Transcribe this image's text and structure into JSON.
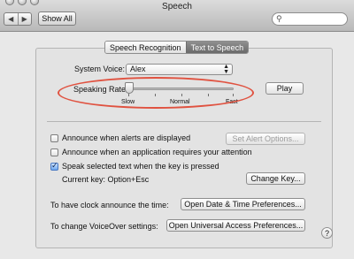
{
  "window": {
    "title": "Speech"
  },
  "toolbar": {
    "back_icon": "◀",
    "forward_icon": "▶",
    "show_all_label": "Show All",
    "search_icon": "⚲",
    "search_placeholder": ""
  },
  "tabs": [
    {
      "label": "Speech Recognition",
      "active": false
    },
    {
      "label": "Text to Speech",
      "active": true
    }
  ],
  "voice": {
    "label": "System Voice:",
    "selected": "Alex",
    "arrows": "▲▼"
  },
  "rate": {
    "label": "Speaking Rate:",
    "slow": "Slow",
    "normal": "Normal",
    "fast": "Fast",
    "value_fraction": 0.0
  },
  "play_label": "Play",
  "options": [
    {
      "label": "Announce when alerts are displayed",
      "checked": false
    },
    {
      "label": "Announce when an application requires your attention",
      "checked": false
    },
    {
      "label": "Speak selected text when the key is pressed",
      "checked": true
    }
  ],
  "alert_options_label": "Set Alert Options...",
  "current_key": "Current key: Option+Esc",
  "change_key_label": "Change Key...",
  "clock": {
    "label": "To have clock announce the time:",
    "button": "Open Date & Time Preferences..."
  },
  "voiceover": {
    "label": "To change VoiceOver settings:",
    "button": "Open Universal Access Preferences..."
  },
  "help_label": "?",
  "colors": {
    "annotation": "#e05240",
    "active_tab": "#6a6a6a",
    "checkbox_checked": "#6ea8ef"
  }
}
